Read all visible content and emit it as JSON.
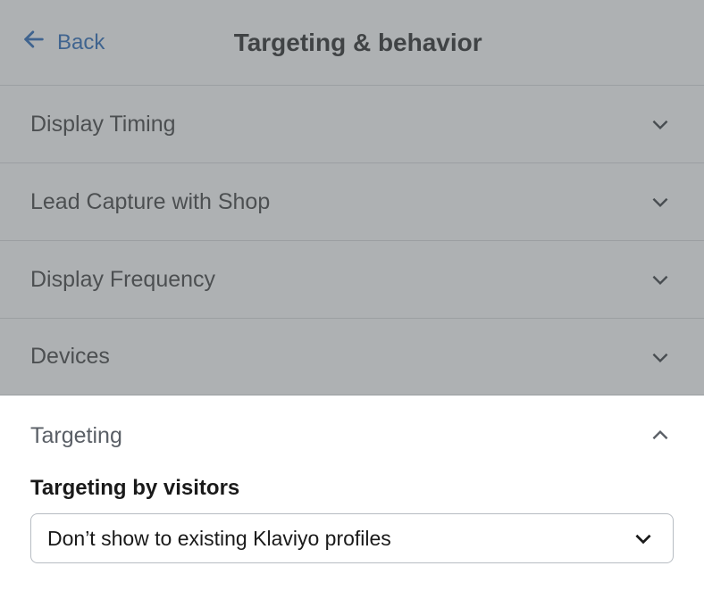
{
  "header": {
    "back_label": "Back",
    "title": "Targeting & behavior"
  },
  "sections": [
    {
      "label": "Display Timing"
    },
    {
      "label": "Lead Capture with Shop"
    },
    {
      "label": "Display Frequency"
    },
    {
      "label": "Devices"
    }
  ],
  "active_section": {
    "label": "Targeting",
    "sub_label": "Targeting by visitors",
    "select_value": "Don’t show to existing Klaviyo profiles"
  }
}
